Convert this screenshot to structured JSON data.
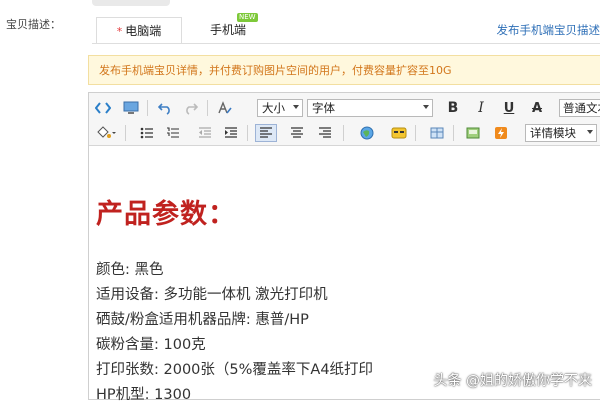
{
  "field_label": "宝贝描述：",
  "tabs": {
    "pc": {
      "label": "电脑端",
      "required_mark": "*"
    },
    "mobile": {
      "label": "手机端",
      "badge": "NEW"
    }
  },
  "publish_link": "发布手机端宝贝描述",
  "notice": "发布手机端宝贝详情，并付费订购图片空间的用户，付费容量扩容至10G",
  "toolbar": {
    "row1": {
      "source_icon": "code-icon",
      "preview_icon": "monitor-icon",
      "undo_icon": "undo-icon",
      "redo_icon": "redo-icon",
      "spellcheck_icon": "text-format-icon",
      "size_select": "大小",
      "font_select": "字体",
      "bold": "B",
      "italic": "I",
      "underline": "U",
      "strike": "A",
      "paragraph_select": "普通文本"
    },
    "row2": {
      "fill_icon": "paint-bucket-icon",
      "bullet_icon": "bullet-list-icon",
      "number_icon": "numbered-list-icon",
      "outdent_icon": "outdent-icon",
      "indent_icon": "indent-icon",
      "align_left_icon": "align-left-icon",
      "align_center_icon": "align-center-icon",
      "align_right_icon": "align-right-icon",
      "link_icon": "globe-link-icon",
      "emoji_icon": "emoticon-icon",
      "table_icon": "table-icon",
      "image_icon": "image-icon",
      "flash_icon": "flash-icon",
      "module_select": "详情模块"
    }
  },
  "content": {
    "heading": "产品参数：",
    "lines": [
      "颜色: 黑色",
      "适用设备: 多功能一体机 激光打印机",
      "硒鼓/粉盒适用机器品牌: 惠普/HP",
      "碳粉含量: 100克",
      "打印张数: 2000张（5%覆盖率下A4纸打印",
      "HP机型: 1300"
    ]
  },
  "watermark": "头条 @姐的娇傲你学不来"
}
